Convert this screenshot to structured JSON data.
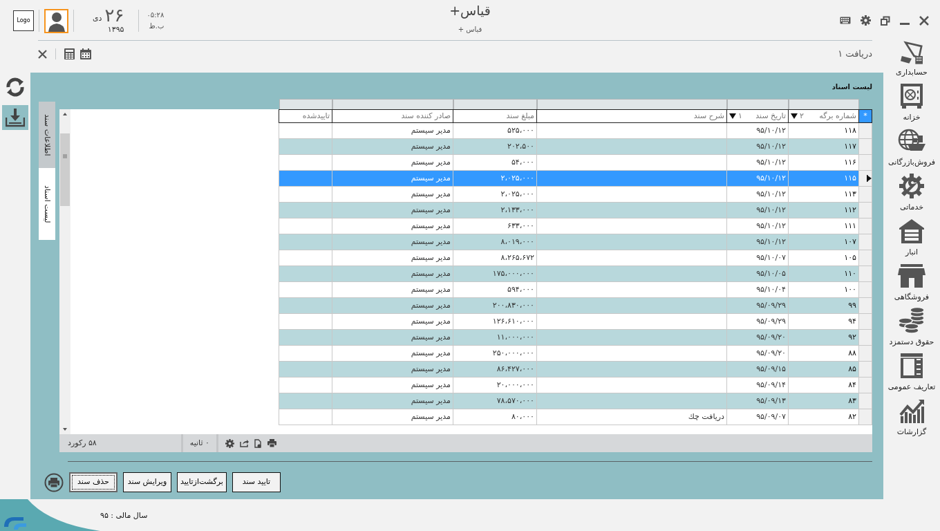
{
  "header": {
    "logo": "Logo",
    "day": "۲۶",
    "month": "دی",
    "year": "۱۳۹۵",
    "time": "۰۵:۲۸",
    "meridiem": "ب.ظ",
    "app_title": "قیاس+",
    "app_subtitle": "قیاس +"
  },
  "toolbar": {
    "document_tab": "دریافت ۱"
  },
  "side_tools": [
    {
      "kind": "refresh",
      "selected": false
    },
    {
      "kind": "download",
      "selected": true
    }
  ],
  "modules": [
    {
      "kind": "accounting",
      "label": "حسابداری"
    },
    {
      "kind": "safe",
      "label": "خزانه"
    },
    {
      "kind": "trade",
      "label": "فروش‌بازرگانی"
    },
    {
      "kind": "service",
      "label": "خدماتی"
    },
    {
      "kind": "warehouse",
      "label": "انبار"
    },
    {
      "kind": "store",
      "label": "فروشگاهی"
    },
    {
      "kind": "payroll",
      "label": "حقوق دستمزد"
    },
    {
      "kind": "definitions",
      "label": "تعاریف عمومی"
    },
    {
      "kind": "reports",
      "label": "گزارشات"
    }
  ],
  "panel": {
    "title": "لیست اسناد",
    "tabs": [
      {
        "label": "اطلاعات سند",
        "selected": false
      },
      {
        "label": "لیست اسناد",
        "selected": true
      }
    ]
  },
  "table": {
    "new_row_marker": "*",
    "columns": [
      {
        "label": "شماره برگه",
        "sort_order": "۲"
      },
      {
        "label": "تاریخ سند",
        "sort_order": "۱"
      },
      {
        "label": "شرح سند"
      },
      {
        "label": "مبلغ سند"
      },
      {
        "label": "صادر کننده سند"
      },
      {
        "label": "تاییدشده"
      }
    ],
    "rows": [
      {
        "number": "۱۱۸",
        "date": "۹۵/۱۰/۱۲",
        "amount": "۵۲۵،۰۰۰",
        "issuer": "مدیر سیستم",
        "selected": false
      },
      {
        "number": "۱۱۷",
        "date": "۹۵/۱۰/۱۲",
        "amount": "۲۰۲،۵۰۰",
        "issuer": "مدیر سیستم",
        "selected": false
      },
      {
        "number": "۱۱۶",
        "date": "۹۵/۱۰/۱۲",
        "amount": "۵۴،۰۰۰",
        "issuer": "مدیر سیستم",
        "selected": false
      },
      {
        "number": "۱۱۵",
        "date": "۹۵/۱۰/۱۲",
        "amount": "۲،۰۲۵،۰۰۰",
        "issuer": "مدیر سیستم",
        "selected": true
      },
      {
        "number": "۱۱۳",
        "date": "۹۵/۱۰/۱۲",
        "amount": "۲،۰۲۵،۰۰۰",
        "issuer": "مدیر سیستم",
        "selected": false
      },
      {
        "number": "۱۱۲",
        "date": "۹۵/۱۰/۱۲",
        "amount": "۲،۱۳۳،۰۰۰",
        "issuer": "مدیر سیستم",
        "selected": false
      },
      {
        "number": "۱۱۱",
        "date": "۹۵/۱۰/۱۲",
        "amount": "۶۳۳،۰۰۰",
        "issuer": "مدیر سیستم",
        "selected": false
      },
      {
        "number": "۱۰۷",
        "date": "۹۵/۱۰/۱۲",
        "amount": "۸،۰۱۹،۰۰۰",
        "issuer": "مدیر سیستم",
        "selected": false
      },
      {
        "number": "۱۰۵",
        "date": "۹۵/۱۰/۰۷",
        "amount": "۸،۲۶۵،۶۷۲",
        "issuer": "مدیر سیستم",
        "selected": false
      },
      {
        "number": "۱۱۰",
        "date": "۹۵/۱۰/۰۵",
        "amount": "۱۷۵،۰۰۰،۰۰۰",
        "issuer": "مدیر سیستم",
        "selected": false
      },
      {
        "number": "۱۰۰",
        "date": "۹۵/۱۰/۰۴",
        "amount": "۵۹۴،۰۰۰",
        "issuer": "مدیر سیستم",
        "selected": false
      },
      {
        "number": "۹۹",
        "date": "۹۵/۰۹/۲۹",
        "amount": "۲۰۰،۸۳۰،۰۰۰",
        "issuer": "مدیر سیستم",
        "selected": false
      },
      {
        "number": "۹۴",
        "date": "۹۵/۰۹/۲۹",
        "amount": "۱۲۶،۶۱۰،۰۰۰",
        "issuer": "مدیر سیستم",
        "selected": false
      },
      {
        "number": "۹۲",
        "date": "۹۵/۰۹/۲۰",
        "amount": "۱۱،۰۰۰،۰۰۰",
        "issuer": "مدیر سیستم",
        "selected": false
      },
      {
        "number": "۸۸",
        "date": "۹۵/۰۹/۲۰",
        "amount": "۲۵۰،۰۰۰،۰۰۰",
        "issuer": "مدیر سیستم",
        "selected": false
      },
      {
        "number": "۸۵",
        "date": "۹۵/۰۹/۱۵",
        "amount": "۸۶،۴۲۷،۰۰۰",
        "issuer": "مدیر سیستم",
        "selected": false
      },
      {
        "number": "۸۴",
        "date": "۹۵/۰۹/۱۴",
        "amount": "۲۰،۰۰۰،۰۰۰",
        "issuer": "مدیر سیستم",
        "selected": false
      },
      {
        "number": "۸۳",
        "date": "۹۵/۰۹/۱۳",
        "amount": "۷۸،۵۷۰،۰۰۰",
        "issuer": "مدیر سیستم",
        "selected": false
      },
      {
        "number": "۸۲",
        "date": "۹۵/۰۹/۰۷",
        "description": "دریافت چك",
        "amount": "۸۰،۰۰۰",
        "issuer": "مدیر سیستم",
        "selected": false
      }
    ]
  },
  "status_bar": {
    "record_count": "۵۸ رکورد",
    "elapsed": "٠ ثانیه"
  },
  "buttons": [
    {
      "label": "تایید سند",
      "focused": false
    },
    {
      "label": "برگشت‌ازتایید",
      "focused": false
    },
    {
      "label": "ویرایش سند",
      "focused": false
    },
    {
      "label": "حذف سند",
      "focused": true
    }
  ],
  "footer": {
    "fiscal_year": "سال مالی : ۹۵"
  }
}
